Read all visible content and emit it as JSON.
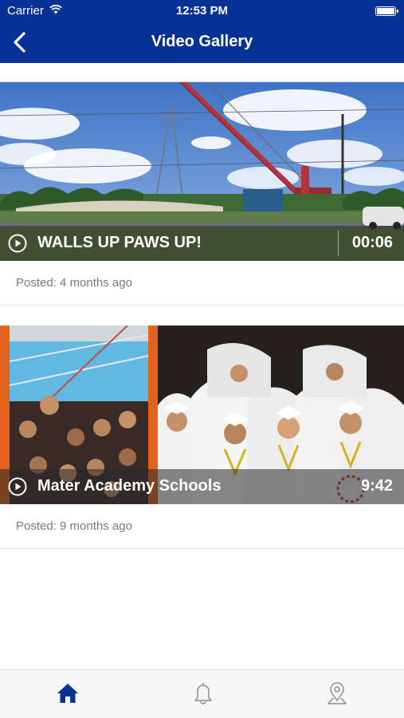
{
  "status_bar": {
    "carrier": "Carrier",
    "time": "12:53 PM"
  },
  "nav": {
    "title": "Video Gallery"
  },
  "videos": [
    {
      "title": "WALLS UP PAWS UP!",
      "duration": "00:06",
      "posted": "Posted: 4 months ago",
      "thumbnail": "construction-site-crane"
    },
    {
      "title": "Mater Academy Schools",
      "duration": "9:42",
      "posted": "Posted: 9 months ago",
      "thumbnail": "graduation-collage"
    }
  ],
  "tab_bar": {
    "items": [
      {
        "icon": "home-icon",
        "active": true
      },
      {
        "icon": "bell-icon",
        "active": false
      },
      {
        "icon": "map-pin-icon",
        "active": false
      }
    ]
  },
  "colors": {
    "nav_bg": "#063296",
    "active_tab": "#063296",
    "inactive_tab": "#8e8e93",
    "posted_text": "#7a7a7a"
  }
}
